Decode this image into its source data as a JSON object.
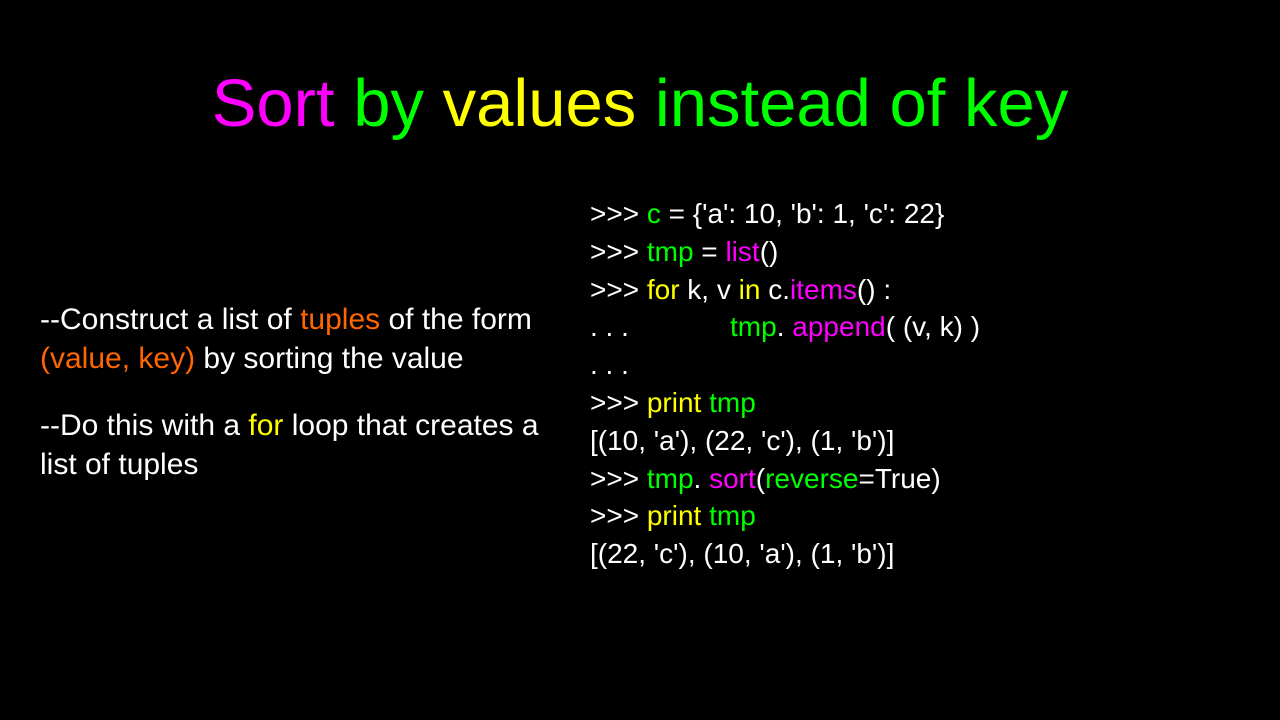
{
  "title": {
    "w1": "Sort",
    "w2": " by ",
    "w3": "values",
    "w4": " instead of key"
  },
  "left": {
    "p1": {
      "t1": "--Construct a list of ",
      "tuples": "tuples",
      "t2": " of the form ",
      "vk": "(value, key)",
      "t3": " by sorting the value"
    },
    "p2": {
      "t1": "--Do this with a ",
      "for": "for",
      "t2": " loop that creates a list of tuples"
    }
  },
  "code": {
    "l1a": ">>> ",
    "l1b": "c",
    "l1c": " = {'a': 10, 'b': 1, 'c': 22}",
    "l2a": ">>> ",
    "l2b": "tmp",
    "l2c": " = ",
    "l2d": "list",
    "l2e": "()",
    "l3a": ">>> ",
    "l3b": "for",
    "l3c": " k, v ",
    "l3d": "in",
    "l3e": " c.",
    "l3f": "items",
    "l3g": "() :",
    "l4a": ". . .             ",
    "l4b": "tmp",
    "l4c": ". ",
    "l4d": "append",
    "l4e": "( (v, k) )",
    "l5": ". . .",
    "l6a": ">>> ",
    "l6b": "print",
    "l6c": " tmp",
    "l7": "[(10, 'a'), (22, 'c'), (1, 'b')]",
    "l8a": ">>> ",
    "l8b": "tmp",
    "l8c": ". ",
    "l8d": "sort",
    "l8e": "(",
    "l8f": "reverse",
    "l8g": "=True)",
    "l9a": ">>> ",
    "l9b": "print",
    "l9c": " tmp",
    "l10": "[(22, 'c'), (10, 'a'), (1, 'b')]"
  }
}
